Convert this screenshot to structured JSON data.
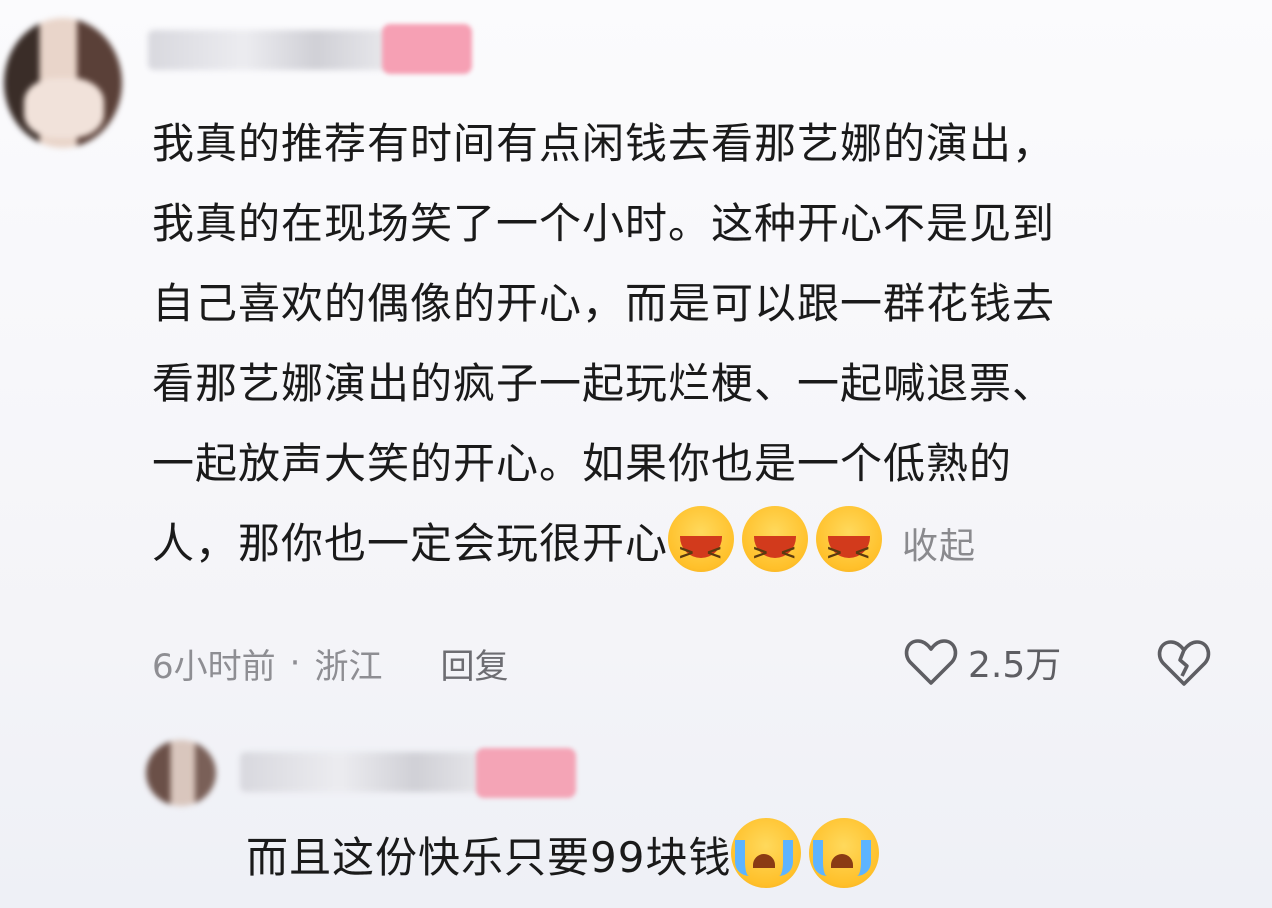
{
  "comment": {
    "lines": [
      "我真的推荐有时间有点闲钱去看那艺娜的演出，",
      "我真的在现场笑了一个小时。这种开心不是见到",
      "自己喜欢的偶像的开心，而是可以跟一群花钱去",
      "看那艺娜演出的疯子一起玩烂梗、一起喊退票、",
      "一起放声大笑的开心。如果你也是一个低熟的",
      "人，那你也一定会玩很开心"
    ],
    "emojis": [
      "laugh-cry-emoji",
      "laugh-cry-emoji",
      "laugh-cry-emoji"
    ],
    "collapse_label": "收起"
  },
  "meta": {
    "time": "6小时前",
    "separator": "·",
    "location": "浙江",
    "reply_label": "回复"
  },
  "actions": {
    "like_icon": "heart-outline-icon",
    "like_count": "2.5万",
    "dislike_icon": "broken-heart-icon"
  },
  "reply": {
    "text": "而且这份快乐只要99块钱",
    "emojis": [
      "sob-emoji",
      "sob-emoji"
    ]
  },
  "colors": {
    "text": "#1a1a1a",
    "meta": "#8e8e93",
    "tag": "#f6a0b4"
  }
}
